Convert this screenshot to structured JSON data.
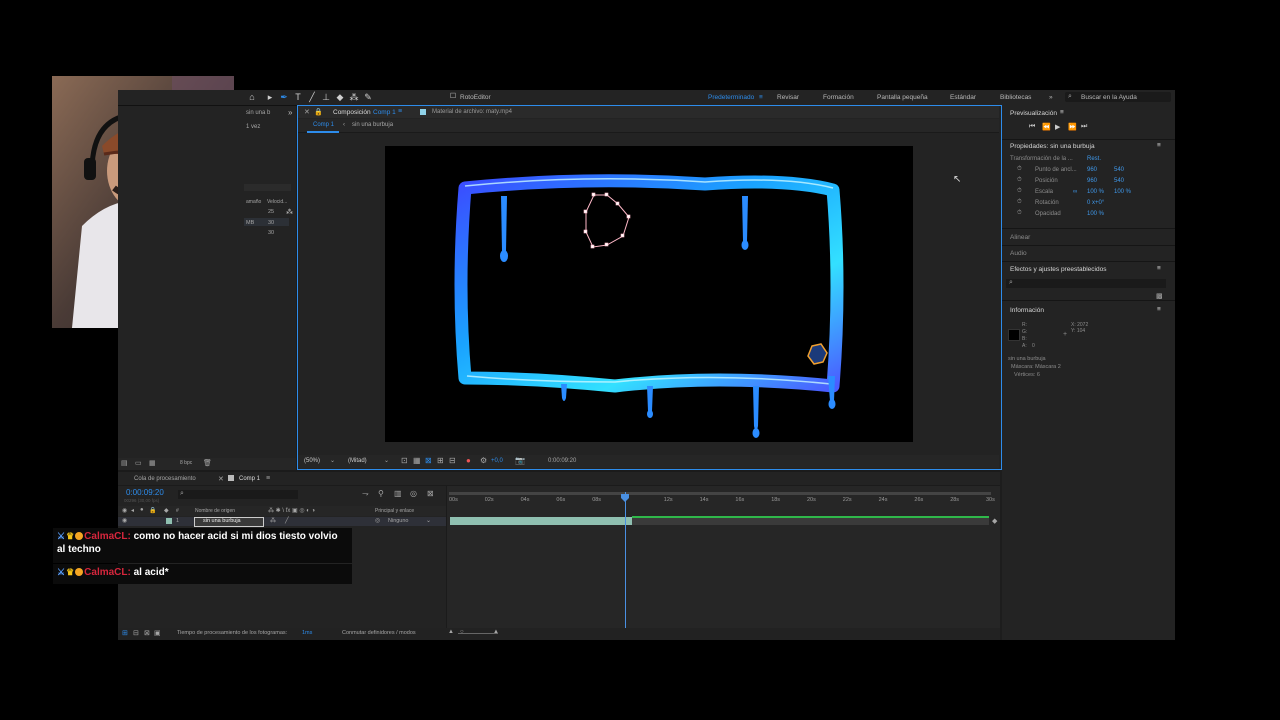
{
  "toolbar": {
    "rotobrush_label": "RotoEditor",
    "workspaces": [
      "Predeterminado",
      "Revisar",
      "Formación",
      "Pantalla pequeña",
      "Estándar",
      "Bibliotecas"
    ],
    "search_placeholder": "Buscar en la Ayuda"
  },
  "project_panel": {
    "item_name": "sin una b",
    "item_usage": "1 vez",
    "col_size": "amaño",
    "col_speed": "Velocid...",
    "rows": [
      {
        "size": "",
        "speed": "25"
      },
      {
        "size": "MB",
        "speed": "30"
      },
      {
        "size": "",
        "speed": "30"
      }
    ],
    "bpc": "8 bpc"
  },
  "composition": {
    "tab_label": "Composición",
    "tab_comp": "Comp 1",
    "footage_tab": "Material de archivo: maty.mp4",
    "breadcrumb_comp": "Comp 1",
    "breadcrumb_layer": "sin una burbuja",
    "zoom": "(50%)",
    "resolution": "(Mitad)",
    "exposure": "+0,0",
    "timecode": "0:00:09:20"
  },
  "preview": {
    "title": "Previsualización"
  },
  "properties": {
    "title": "Propiedades: sin una burbuja",
    "transform_label": "Transformación de la ...",
    "reset": "Rest.",
    "anchor_label": "Punto de ancl...",
    "anchor_x": "960",
    "anchor_y": "540",
    "position_label": "Posición",
    "position_x": "960",
    "position_y": "540",
    "scale_label": "Escala",
    "scale_x": "100 %",
    "scale_y": "100 %",
    "rotation_label": "Rotación",
    "rotation": "0 x+0°",
    "opacity_label": "Opacidad",
    "opacity": "100 %"
  },
  "side_sections": {
    "align": "Alinear",
    "audio": "Audio",
    "effects": "Efectos y ajustes preestablecidos",
    "info": "Información"
  },
  "info": {
    "r": "R:",
    "g": "G:",
    "b": "B:",
    "a": "A:",
    "a_val": "0",
    "x": "X: 2072",
    "y": "Y: 104",
    "layer": "sin una burbuja",
    "mask": "Máscara: Máscara 2",
    "vertices": "Vértices: 6"
  },
  "timeline": {
    "tab_queue": "Cola de procesamiento",
    "tab_comp": "Comp 1",
    "timecode": "0:00:09:20",
    "frames": "00296 (30,00 fps)",
    "col_source": "Nombre de origen",
    "col_parent": "Principal y enlace",
    "layer_num": "1",
    "layer_name": "sin una burbuja",
    "parent_value": "Ninguno",
    "ruler": [
      "00s",
      "02s",
      "04s",
      "06s",
      "08s",
      "",
      "12s",
      "14s",
      "16s",
      "18s",
      "20s",
      "22s",
      "24s",
      "26s",
      "28s",
      "30s"
    ]
  },
  "statusbar": {
    "render_time_label": "Tiempo de procesamiento de los fotogramas:",
    "render_time_value": "1ms",
    "toggle_label": "Conmutar definidores / modos"
  },
  "chat": [
    {
      "user": "CalmaCL:",
      "text": "como no hacer acid si mi dios tiesto volvio al techno"
    },
    {
      "user": "CalmaCL:",
      "text": "al acid*"
    }
  ],
  "colors": {
    "accent_blue": "#2d8ceb",
    "value_blue": "#3f98ea",
    "chat_user": "#d7263d",
    "playhead": "#4a90e2",
    "layer_bar": "#8fbfb0"
  }
}
